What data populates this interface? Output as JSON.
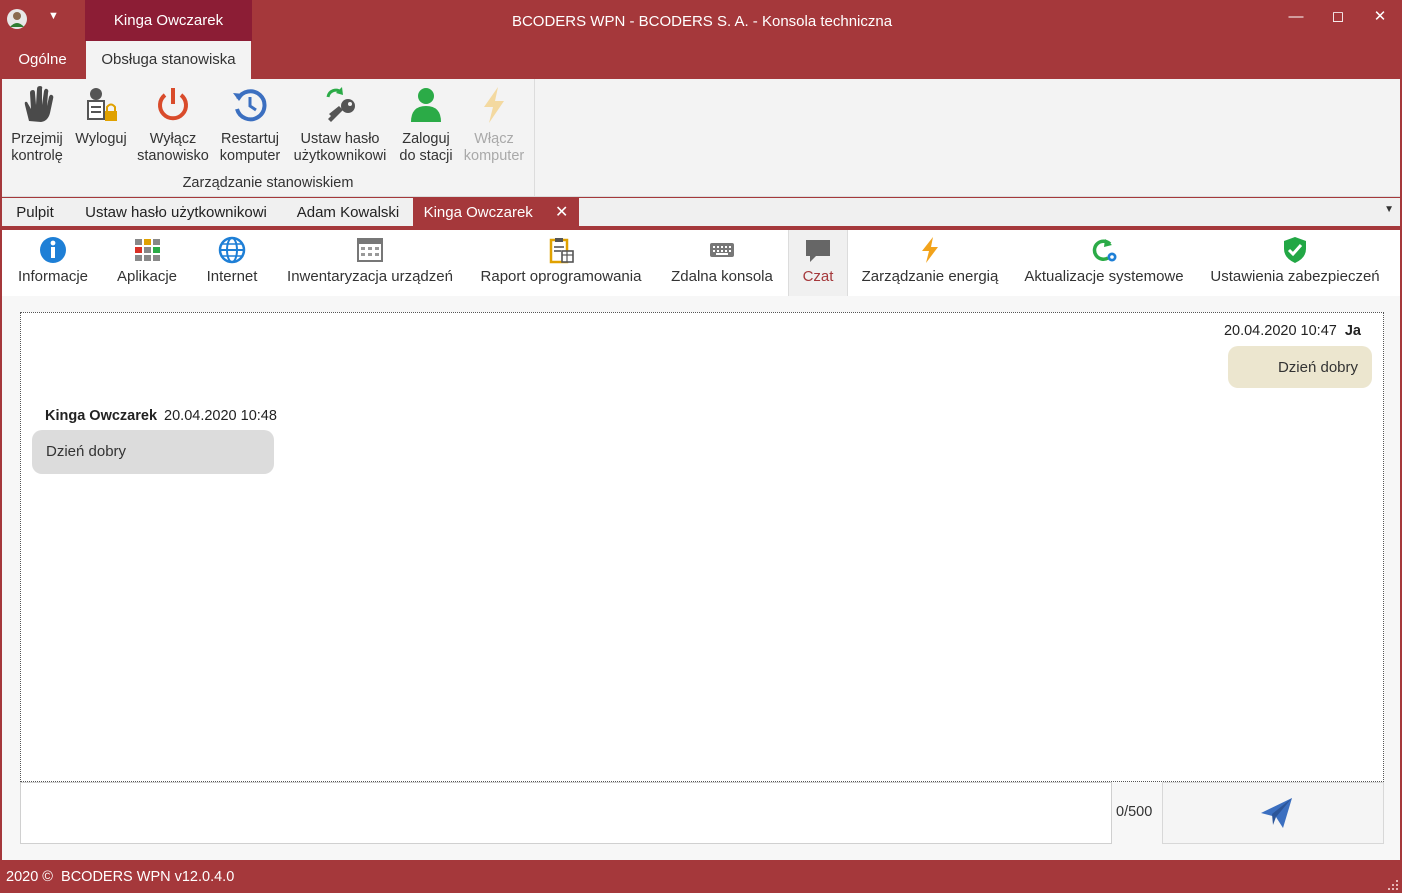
{
  "titlebar": {
    "user_tab": "Kinga Owczarek",
    "title": "BCODERS WPN - BCODERS S. A. - Konsola techniczna",
    "menu_icon": "chevron-down-icon"
  },
  "ribbon_tabs": [
    "Ogólne",
    "Obsługa stanowiska"
  ],
  "ribbon": {
    "buttons": [
      {
        "label": "Przejmij\nkontrolę",
        "icon": "hand-icon"
      },
      {
        "label": "Wyloguj",
        "icon": "user-lock-icon"
      },
      {
        "label": "Wyłącz\nstanowisko",
        "icon": "power-icon"
      },
      {
        "label": "Restartuj\nkomputer",
        "icon": "restart-icon"
      },
      {
        "label": "Ustaw hasło\nużytkownikowi",
        "icon": "key-refresh-icon"
      },
      {
        "label": "Zaloguj\ndo stacji",
        "icon": "user-icon"
      },
      {
        "label": "Włącz\nkomputer",
        "icon": "bolt-icon",
        "disabled": true
      }
    ],
    "group_label": "Zarządzanie stanowiskiem"
  },
  "doc_tabs": [
    "Pulpit",
    "Ustaw hasło użytkownikowi",
    "Adam Kowalski",
    "Kinga Owczarek"
  ],
  "doc_tab_close": "✕",
  "features": [
    {
      "label": "Informacje",
      "icon": "info-icon"
    },
    {
      "label": "Aplikacje",
      "icon": "apps-grid-icon"
    },
    {
      "label": "Internet",
      "icon": "globe-icon"
    },
    {
      "label": "Inwentaryzacja urządzeń",
      "icon": "calendar-grid-icon"
    },
    {
      "label": "Raport oprogramowania",
      "icon": "clipboard-report-icon"
    },
    {
      "label": "Zdalna konsola",
      "icon": "keyboard-icon"
    },
    {
      "label": "Czat",
      "icon": "chat-bubble-icon",
      "active": true
    },
    {
      "label": "Zarządzanie energią",
      "icon": "bolt-icon"
    },
    {
      "label": "Aktualizacje systemowe",
      "icon": "update-gear-icon"
    },
    {
      "label": "Ustawienia zabezpieczeń",
      "icon": "shield-check-icon"
    }
  ],
  "chat": {
    "messages": [
      {
        "author": "Ja",
        "time": "20.04.2020 10:47",
        "text": "Dzień dobry",
        "mine": true
      },
      {
        "author": "Kinga Owczarek",
        "time": "20.04.2020 10:48",
        "text": "Dzień dobry",
        "mine": false
      }
    ],
    "char_count": "0/500",
    "send_icon": "send-icon"
  },
  "statusbar": {
    "text": "2020 ©  BCODERS WPN v12.0.4.0"
  },
  "colors": {
    "accent": "#a5383b",
    "accent_dark": "#8c1d35",
    "my_bubble": "#ece6cf",
    "their_bubble": "#dcdcdc"
  }
}
